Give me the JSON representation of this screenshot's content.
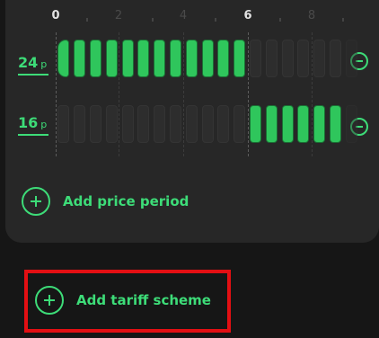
{
  "timeline": {
    "hour_labels": [
      "0",
      "2",
      "4",
      "6",
      "8"
    ],
    "dim_hour_labels": [
      "2",
      "4",
      "8"
    ]
  },
  "periods": [
    {
      "price": "24",
      "unit": "p",
      "active_slots": [
        0,
        12
      ],
      "remove_icon": "minus-circle-icon"
    },
    {
      "price": "16",
      "unit": "p",
      "active_slots": [
        12,
        18
      ],
      "remove_icon": "minus-circle-icon"
    }
  ],
  "actions": {
    "add_price_period": "Add price period",
    "add_tariff_scheme": "Add tariff scheme"
  },
  "colors": {
    "accent": "#3ddc78",
    "bar_fill": "#2fc65c",
    "card_bg": "#272727",
    "page_bg": "#161616",
    "highlight": "#e30f13"
  }
}
